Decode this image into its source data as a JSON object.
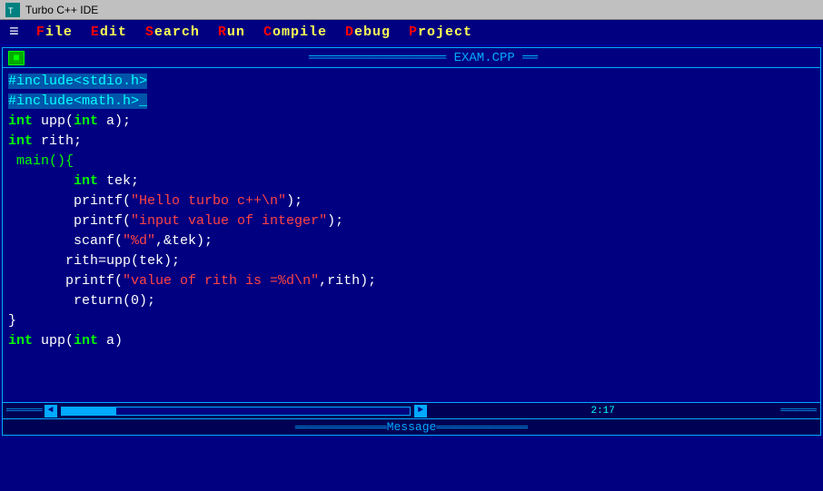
{
  "titleBar": {
    "icon": "turbo-cpp-icon",
    "text": "Turbo C++ IDE"
  },
  "menuBar": {
    "hamburger": "≡",
    "items": [
      {
        "label": "File",
        "firstLetter": "F",
        "rest": "ile"
      },
      {
        "label": "Edit",
        "firstLetter": "E",
        "rest": "dit"
      },
      {
        "label": "Search",
        "firstLetter": "S",
        "rest": "earch"
      },
      {
        "label": "Run",
        "firstLetter": "R",
        "rest": "un"
      },
      {
        "label": "Compile",
        "firstLetter": "C",
        "rest": "ompile"
      },
      {
        "label": "Debug",
        "firstLetter": "D",
        "rest": "ebug"
      },
      {
        "label": "Project",
        "firstLetter": "P",
        "rest": "roject"
      }
    ]
  },
  "fileWindow": {
    "title": "EXAM.CPP",
    "closeBtn": "■"
  },
  "code": [
    "#include<stdio.h>",
    "#include<math.h>_",
    "int upp(int a);",
    "int rith;",
    " main(){",
    "        int tek;",
    "        printf(\"Hello turbo c++\\n\");",
    "        printf(\"input value of integer\");",
    "        scanf(\"%d\",&tek);",
    "       rith=upp(tek);",
    "       printf(\"value of rith is =%d\\n\",rith);",
    "        return(0);",
    "}",
    "int upp(int a)"
  ],
  "statusBar": {
    "position": "2:17"
  },
  "messageArea": {
    "title": "Message"
  }
}
